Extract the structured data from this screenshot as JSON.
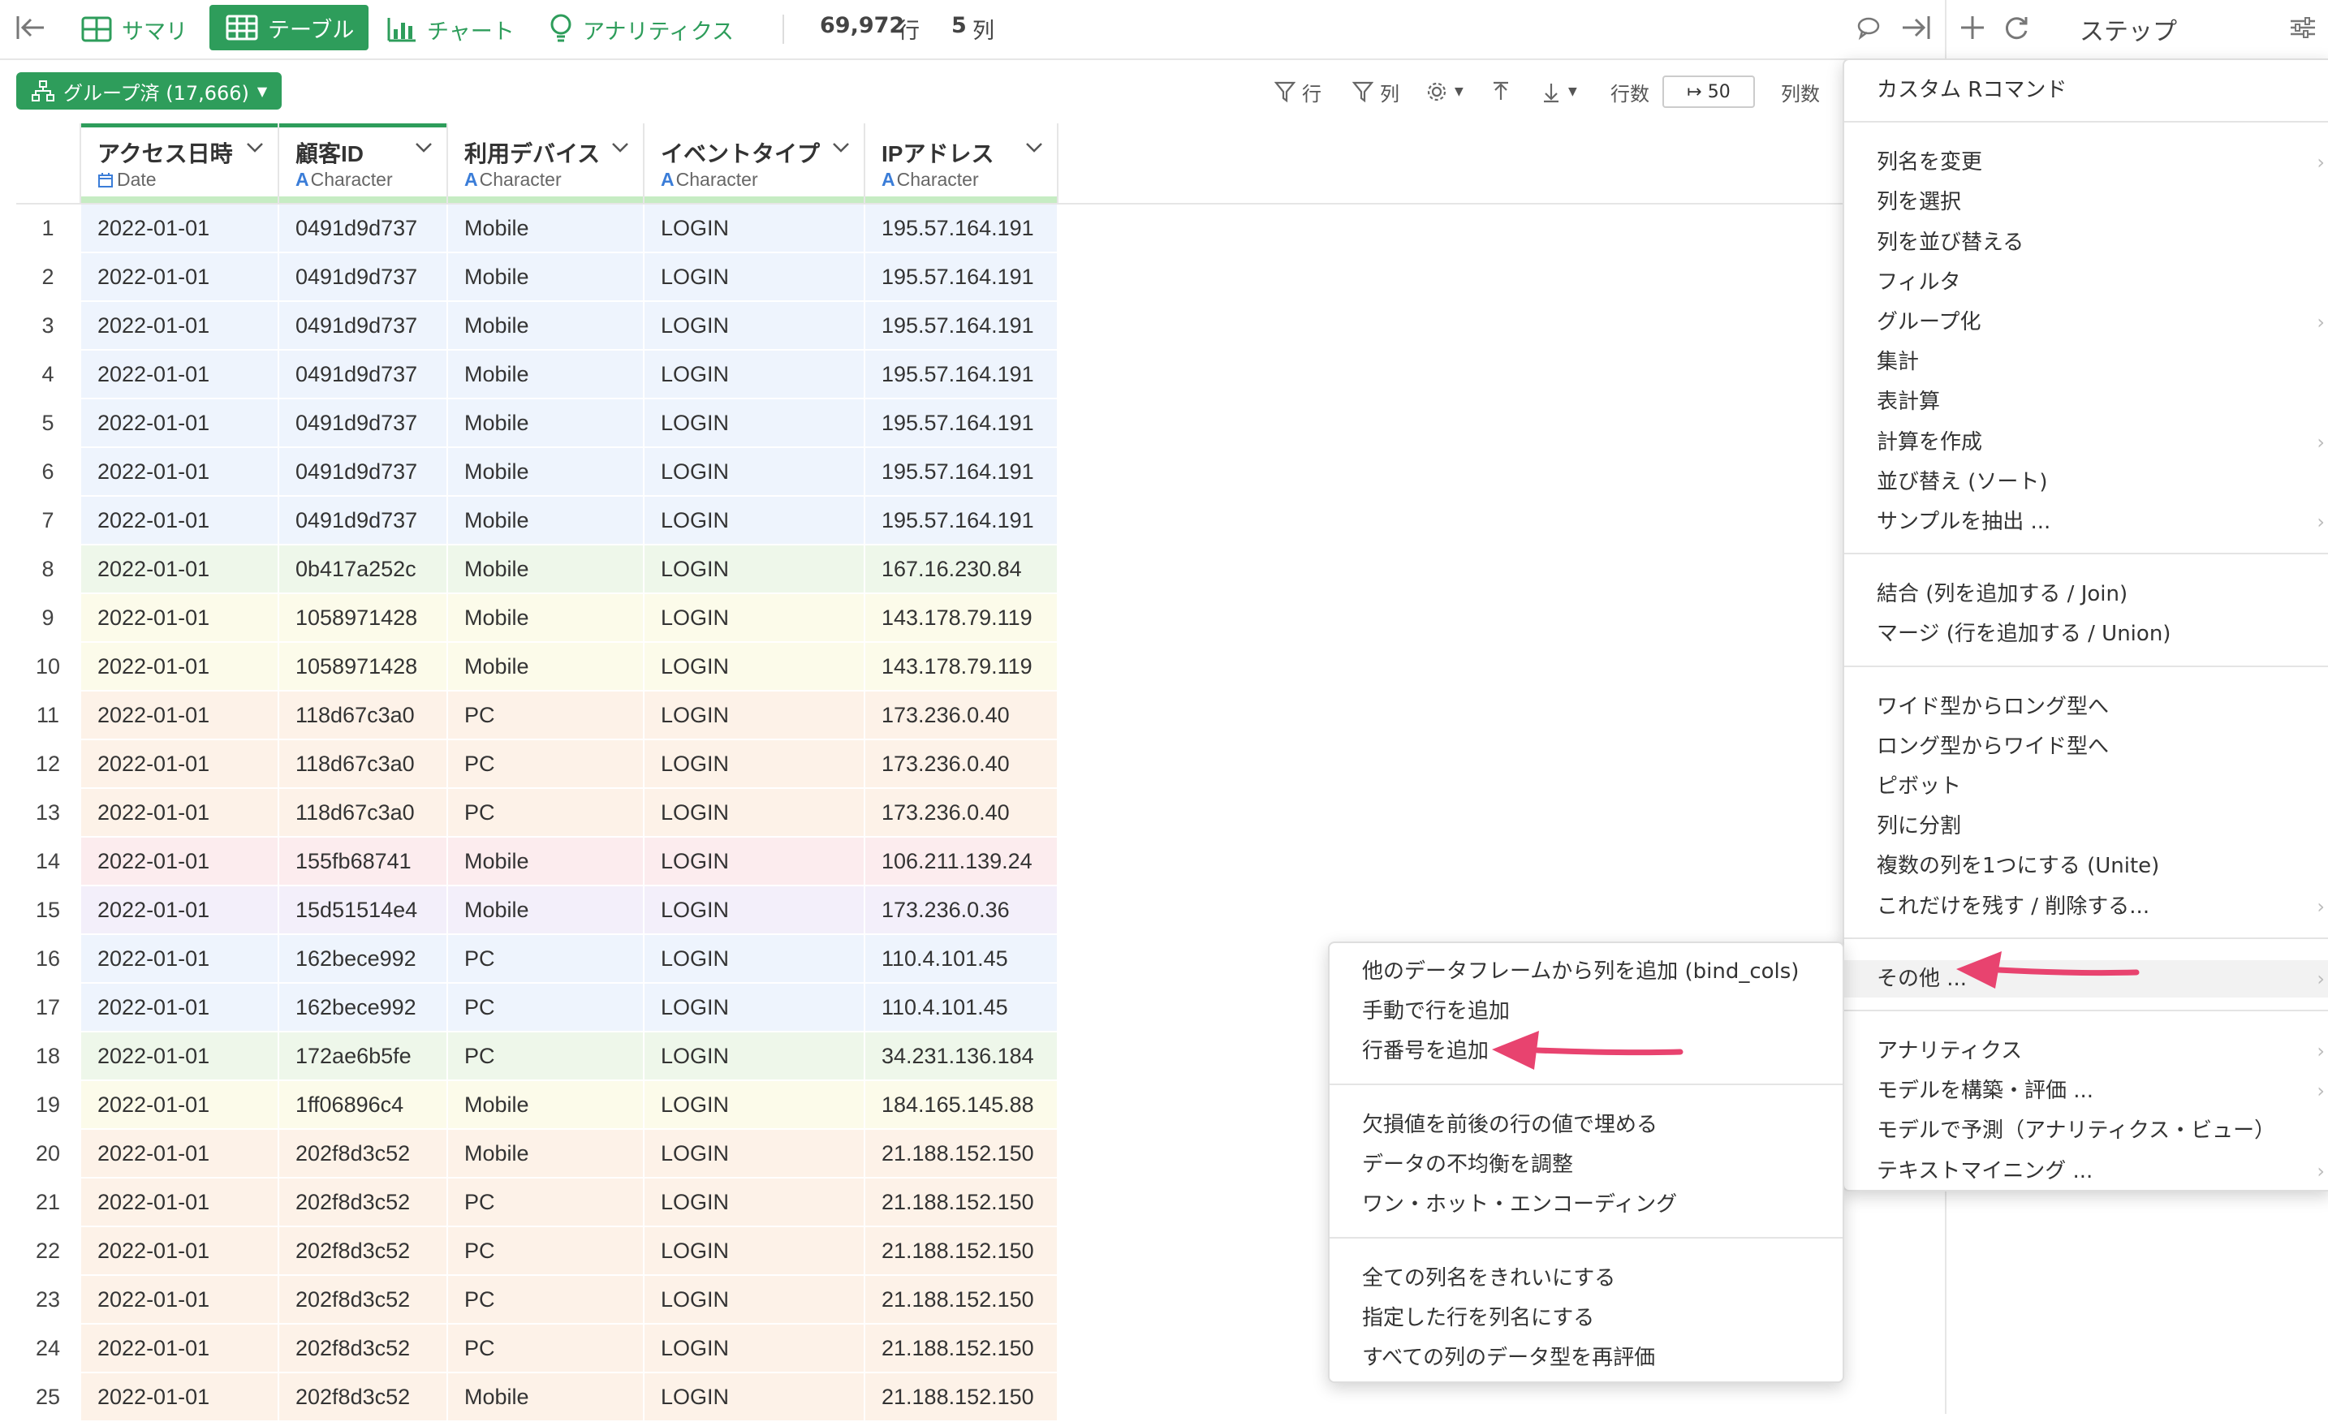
{
  "toolbar": {
    "tabs": [
      {
        "label": "サマリ",
        "icon": "grid-icon"
      },
      {
        "label": "テーブル",
        "icon": "table-icon"
      },
      {
        "label": "チャート",
        "icon": "bar-chart-icon"
      },
      {
        "label": "アナリティクス",
        "icon": "lightbulb-icon"
      }
    ],
    "row_count": "69,972",
    "row_unit": "行",
    "col_count": "5",
    "col_unit": "列",
    "steps_label": "ステップ"
  },
  "subbar": {
    "grouped_label": "グループ済 (17,666)",
    "filter_row": "行",
    "filter_col": "列",
    "rows_label": "行数",
    "rows_value": "↦ 50",
    "cols_label": "列数"
  },
  "table": {
    "columns": [
      {
        "name": "アクセス日時",
        "type": "Date",
        "type_icon": "calendar-icon"
      },
      {
        "name": "顧客ID",
        "type": "Character",
        "type_icon": "A"
      },
      {
        "name": "利用デバイス",
        "type": "Character",
        "type_icon": "A"
      },
      {
        "name": "イベントタイプ",
        "type": "Character",
        "type_icon": "A"
      },
      {
        "name": "IPアドレス",
        "type": "Character",
        "type_icon": "A"
      }
    ],
    "rows": [
      {
        "n": "1",
        "date": "2022-01-01",
        "id": "0491d9d737",
        "device": "Mobile",
        "event": "LOGIN",
        "ip": "195.57.164.191",
        "bg": "#eef4fd"
      },
      {
        "n": "2",
        "date": "2022-01-01",
        "id": "0491d9d737",
        "device": "Mobile",
        "event": "LOGIN",
        "ip": "195.57.164.191",
        "bg": "#eef4fd"
      },
      {
        "n": "3",
        "date": "2022-01-01",
        "id": "0491d9d737",
        "device": "Mobile",
        "event": "LOGIN",
        "ip": "195.57.164.191",
        "bg": "#eef4fd"
      },
      {
        "n": "4",
        "date": "2022-01-01",
        "id": "0491d9d737",
        "device": "Mobile",
        "event": "LOGIN",
        "ip": "195.57.164.191",
        "bg": "#eef4fd"
      },
      {
        "n": "5",
        "date": "2022-01-01",
        "id": "0491d9d737",
        "device": "Mobile",
        "event": "LOGIN",
        "ip": "195.57.164.191",
        "bg": "#eef4fd"
      },
      {
        "n": "6",
        "date": "2022-01-01",
        "id": "0491d9d737",
        "device": "Mobile",
        "event": "LOGIN",
        "ip": "195.57.164.191",
        "bg": "#eef4fd"
      },
      {
        "n": "7",
        "date": "2022-01-01",
        "id": "0491d9d737",
        "device": "Mobile",
        "event": "LOGIN",
        "ip": "195.57.164.191",
        "bg": "#eef4fd"
      },
      {
        "n": "8",
        "date": "2022-01-01",
        "id": "0b417a252c",
        "device": "Mobile",
        "event": "LOGIN",
        "ip": "167.16.230.84",
        "bg": "#eef7ea"
      },
      {
        "n": "9",
        "date": "2022-01-01",
        "id": "1058971428",
        "device": "Mobile",
        "event": "LOGIN",
        "ip": "143.178.79.119",
        "bg": "#fcfbea"
      },
      {
        "n": "10",
        "date": "2022-01-01",
        "id": "1058971428",
        "device": "Mobile",
        "event": "LOGIN",
        "ip": "143.178.79.119",
        "bg": "#fcfbea"
      },
      {
        "n": "11",
        "date": "2022-01-01",
        "id": "118d67c3a0",
        "device": "PC",
        "event": "LOGIN",
        "ip": "173.236.0.40",
        "bg": "#fdf2e8"
      },
      {
        "n": "12",
        "date": "2022-01-01",
        "id": "118d67c3a0",
        "device": "PC",
        "event": "LOGIN",
        "ip": "173.236.0.40",
        "bg": "#fdf2e8"
      },
      {
        "n": "13",
        "date": "2022-01-01",
        "id": "118d67c3a0",
        "device": "PC",
        "event": "LOGIN",
        "ip": "173.236.0.40",
        "bg": "#fdf2e8"
      },
      {
        "n": "14",
        "date": "2022-01-01",
        "id": "155fb68741",
        "device": "Mobile",
        "event": "LOGIN",
        "ip": "106.211.139.24",
        "bg": "#fcecee"
      },
      {
        "n": "15",
        "date": "2022-01-01",
        "id": "15d51514e4",
        "device": "Mobile",
        "event": "LOGIN",
        "ip": "173.236.0.36",
        "bg": "#f3effa"
      },
      {
        "n": "16",
        "date": "2022-01-01",
        "id": "162bece992",
        "device": "PC",
        "event": "LOGIN",
        "ip": "110.4.101.45",
        "bg": "#eef4fd"
      },
      {
        "n": "17",
        "date": "2022-01-01",
        "id": "162bece992",
        "device": "PC",
        "event": "LOGIN",
        "ip": "110.4.101.45",
        "bg": "#eef4fd"
      },
      {
        "n": "18",
        "date": "2022-01-01",
        "id": "172ae6b5fe",
        "device": "PC",
        "event": "LOGIN",
        "ip": "34.231.136.184",
        "bg": "#eef7ea"
      },
      {
        "n": "19",
        "date": "2022-01-01",
        "id": "1ff06896c4",
        "device": "Mobile",
        "event": "LOGIN",
        "ip": "184.165.145.88",
        "bg": "#fcfbea"
      },
      {
        "n": "20",
        "date": "2022-01-01",
        "id": "202f8d3c52",
        "device": "Mobile",
        "event": "LOGIN",
        "ip": "21.188.152.150",
        "bg": "#fdf2e8"
      },
      {
        "n": "21",
        "date": "2022-01-01",
        "id": "202f8d3c52",
        "device": "PC",
        "event": "LOGIN",
        "ip": "21.188.152.150",
        "bg": "#fdf2e8"
      },
      {
        "n": "22",
        "date": "2022-01-01",
        "id": "202f8d3c52",
        "device": "PC",
        "event": "LOGIN",
        "ip": "21.188.152.150",
        "bg": "#fdf2e8"
      },
      {
        "n": "23",
        "date": "2022-01-01",
        "id": "202f8d3c52",
        "device": "PC",
        "event": "LOGIN",
        "ip": "21.188.152.150",
        "bg": "#fdf2e8"
      },
      {
        "n": "24",
        "date": "2022-01-01",
        "id": "202f8d3c52",
        "device": "PC",
        "event": "LOGIN",
        "ip": "21.188.152.150",
        "bg": "#fdf2e8"
      },
      {
        "n": "25",
        "date": "2022-01-01",
        "id": "202f8d3c52",
        "device": "Mobile",
        "event": "LOGIN",
        "ip": "21.188.152.150",
        "bg": "#fdf2e8"
      }
    ]
  },
  "step_menu": {
    "items": [
      {
        "label": "カスタム Rコマンド",
        "sub": false
      },
      {
        "label": "列名を変更",
        "sub": true
      },
      {
        "label": "列を選択",
        "sub": false
      },
      {
        "label": "列を並び替える",
        "sub": false
      },
      {
        "label": "フィルタ",
        "sub": false
      },
      {
        "label": "グループ化",
        "sub": true
      },
      {
        "label": "集計",
        "sub": false
      },
      {
        "label": "表計算",
        "sub": false
      },
      {
        "label": "計算を作成",
        "sub": true
      },
      {
        "label": "並び替え (ソート)",
        "sub": false
      },
      {
        "label": "サンプルを抽出 ...",
        "sub": true
      },
      {
        "label": "結合 (列を追加する / Join)",
        "sub": false
      },
      {
        "label": "マージ (行を追加する / Union)",
        "sub": false
      },
      {
        "label": "ワイド型からロング型へ",
        "sub": false
      },
      {
        "label": "ロング型からワイド型へ",
        "sub": false
      },
      {
        "label": "ピボット",
        "sub": false
      },
      {
        "label": "列に分割",
        "sub": false
      },
      {
        "label": "複数の列を1つにする (Unite)",
        "sub": false
      },
      {
        "label": "これだけを残す / 削除する...",
        "sub": true
      },
      {
        "label": "その他 ...",
        "sub": true
      },
      {
        "label": "アナリティクス",
        "sub": true
      },
      {
        "label": "モデルを構築・評価 ...",
        "sub": true
      },
      {
        "label": "モデルで予測（アナリティクス・ビュー）",
        "sub": false
      },
      {
        "label": "テキストマイニング ...",
        "sub": true
      }
    ]
  },
  "other_menu": {
    "items": [
      {
        "label": "他のデータフレームから列を追加 (bind_cols)"
      },
      {
        "label": "手動で行を追加"
      },
      {
        "label": "行番号を追加"
      },
      {
        "label": "欠損値を前後の行の値で埋める"
      },
      {
        "label": "データの不均衡を調整"
      },
      {
        "label": "ワン・ホット・エンコーディング"
      },
      {
        "label": "全ての列名をきれいにする"
      },
      {
        "label": "指定した行を列名にする"
      },
      {
        "label": "すべての列のデータ型を再評価"
      }
    ]
  },
  "colors": {
    "brand": "#2e9d5b",
    "arrow": "#e8436f"
  }
}
